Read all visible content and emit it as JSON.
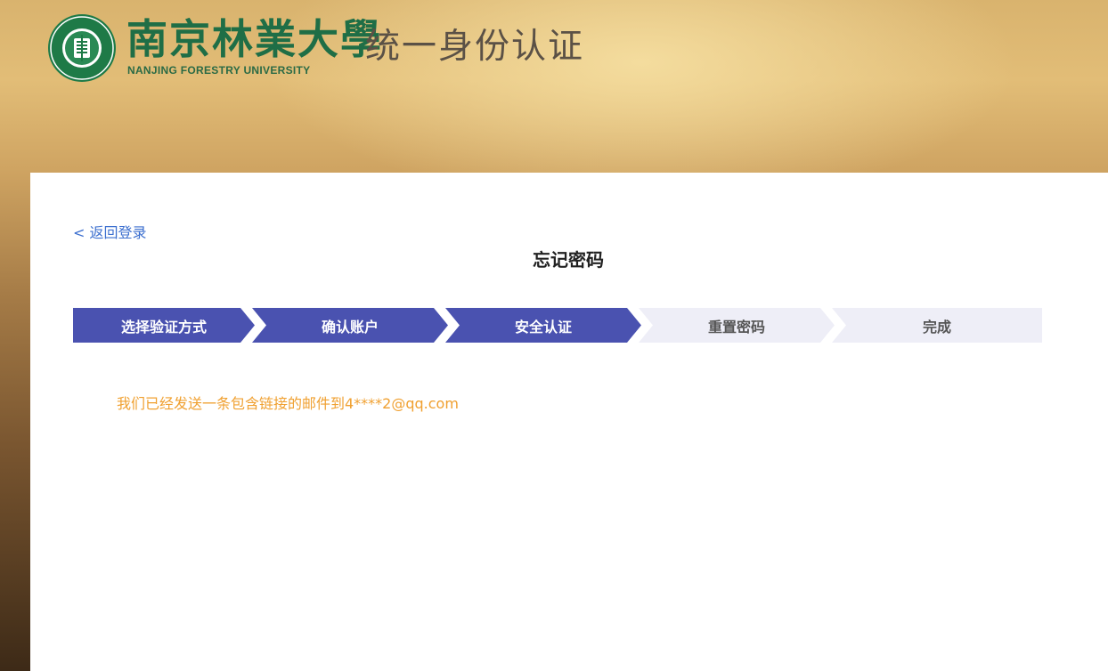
{
  "header": {
    "brand_cn": "南京林業大學",
    "brand_en": "NANJING FORESTRY UNIVERSITY",
    "system_title": "统一身份认证",
    "logo_ring_text": "NANJING FORESTRY UNIVERSITY",
    "logo_bottom_text": "南京林業大學"
  },
  "panel": {
    "back_link": "< 返回登录",
    "title": "忘记密码",
    "steps": [
      {
        "label": "选择验证方式",
        "state": "active"
      },
      {
        "label": "确认账户",
        "state": "active"
      },
      {
        "label": "安全认证",
        "state": "active"
      },
      {
        "label": "重置密码",
        "state": "inactive"
      },
      {
        "label": "完成",
        "state": "inactive"
      }
    ],
    "message": "我们已经发送一条包含链接的邮件到4****2@qq.com"
  },
  "colors": {
    "step_active": "#4a52b0",
    "step_inactive": "#eeeef7",
    "link": "#3c6fcf",
    "message": "#f0a030",
    "brand_green": "#1f6e46"
  }
}
